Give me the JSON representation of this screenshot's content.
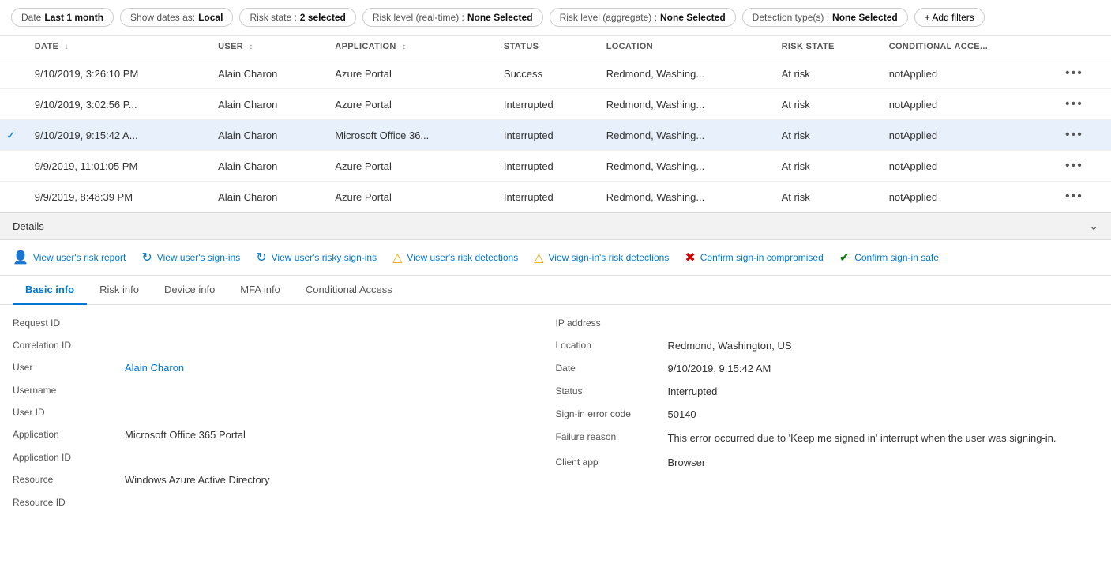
{
  "filters": {
    "date": {
      "key": "Date",
      "value": "Last 1 month"
    },
    "showDates": {
      "key": "Show dates as:",
      "value": "Local"
    },
    "riskState": {
      "key": "Risk state :",
      "value": "2 selected"
    },
    "riskLevelRealtime": {
      "key": "Risk level (real-time) :",
      "value": "None Selected"
    },
    "riskLevelAggregate": {
      "key": "Risk level (aggregate) :",
      "value": "None Selected"
    },
    "detectionTypes": {
      "key": "Detection type(s) :",
      "value": "None Selected"
    },
    "addFilters": "+ Add filters"
  },
  "table": {
    "columns": [
      {
        "label": "DATE",
        "sortable": true
      },
      {
        "label": "USER",
        "sortable": true
      },
      {
        "label": "APPLICATION",
        "sortable": true
      },
      {
        "label": "STATUS",
        "sortable": false
      },
      {
        "label": "LOCATION",
        "sortable": false
      },
      {
        "label": "RISK STATE",
        "sortable": false
      },
      {
        "label": "CONDITIONAL ACCE...",
        "sortable": false
      }
    ],
    "rows": [
      {
        "date": "9/10/2019, 3:26:10 PM",
        "user": "Alain Charon",
        "application": "Azure Portal",
        "status": "Success",
        "location": "Redmond, Washing...",
        "riskState": "At risk",
        "conditionalAccess": "notApplied",
        "selected": false
      },
      {
        "date": "9/10/2019, 3:02:56 P...",
        "user": "Alain Charon",
        "application": "Azure Portal",
        "status": "Interrupted",
        "location": "Redmond, Washing...",
        "riskState": "At risk",
        "conditionalAccess": "notApplied",
        "selected": false
      },
      {
        "date": "9/10/2019, 9:15:42 A...",
        "user": "Alain Charon",
        "application": "Microsoft Office 36...",
        "status": "Interrupted",
        "location": "Redmond, Washing...",
        "riskState": "At risk",
        "conditionalAccess": "notApplied",
        "selected": true
      },
      {
        "date": "9/9/2019, 11:01:05 PM",
        "user": "Alain Charon",
        "application": "Azure Portal",
        "status": "Interrupted",
        "location": "Redmond, Washing...",
        "riskState": "At risk",
        "conditionalAccess": "notApplied",
        "selected": false
      },
      {
        "date": "9/9/2019, 8:48:39 PM",
        "user": "Alain Charon",
        "application": "Azure Portal",
        "status": "Interrupted",
        "location": "Redmond, Washing...",
        "riskState": "At risk",
        "conditionalAccess": "notApplied",
        "selected": false
      }
    ]
  },
  "details": {
    "header": "Details",
    "actions": [
      {
        "icon": "👤",
        "label": "View user's risk report"
      },
      {
        "icon": "↻",
        "label": "View user's sign-ins"
      },
      {
        "icon": "↻",
        "label": "View user's risky sign-ins"
      },
      {
        "icon": "⚠",
        "label": "View user's risk detections"
      },
      {
        "icon": "⚠",
        "label": "View sign-in's risk detections"
      },
      {
        "icon": "✖",
        "label": "Confirm sign-in compromised"
      },
      {
        "icon": "✔",
        "label": "Confirm sign-in safe"
      }
    ],
    "tabs": [
      {
        "label": "Basic info",
        "active": true
      },
      {
        "label": "Risk info",
        "active": false
      },
      {
        "label": "Device info",
        "active": false
      },
      {
        "label": "MFA info",
        "active": false
      },
      {
        "label": "Conditional Access",
        "active": false
      }
    ],
    "left": {
      "fields": [
        {
          "label": "Request ID",
          "value": ""
        },
        {
          "label": "Correlation ID",
          "value": ""
        },
        {
          "label": "User",
          "value": "Alain Charon",
          "isLink": true
        },
        {
          "label": "Username",
          "value": ""
        },
        {
          "label": "User ID",
          "value": ""
        },
        {
          "label": "Application",
          "value": "Microsoft Office 365 Portal"
        },
        {
          "label": "Application ID",
          "value": ""
        },
        {
          "label": "Resource",
          "value": "Windows Azure Active Directory"
        },
        {
          "label": "Resource ID",
          "value": ""
        }
      ]
    },
    "right": {
      "fields": [
        {
          "label": "IP address",
          "value": ""
        },
        {
          "label": "Location",
          "value": "Redmond, Washington, US"
        },
        {
          "label": "Date",
          "value": "9/10/2019, 9:15:42 AM"
        },
        {
          "label": "Status",
          "value": "Interrupted"
        },
        {
          "label": "Sign-in error code",
          "value": "50140"
        },
        {
          "label": "Failure reason",
          "value": "This error occurred due to 'Keep me signed in' interrupt when the user was signing-in."
        },
        {
          "label": "Client app",
          "value": "Browser"
        }
      ]
    }
  }
}
